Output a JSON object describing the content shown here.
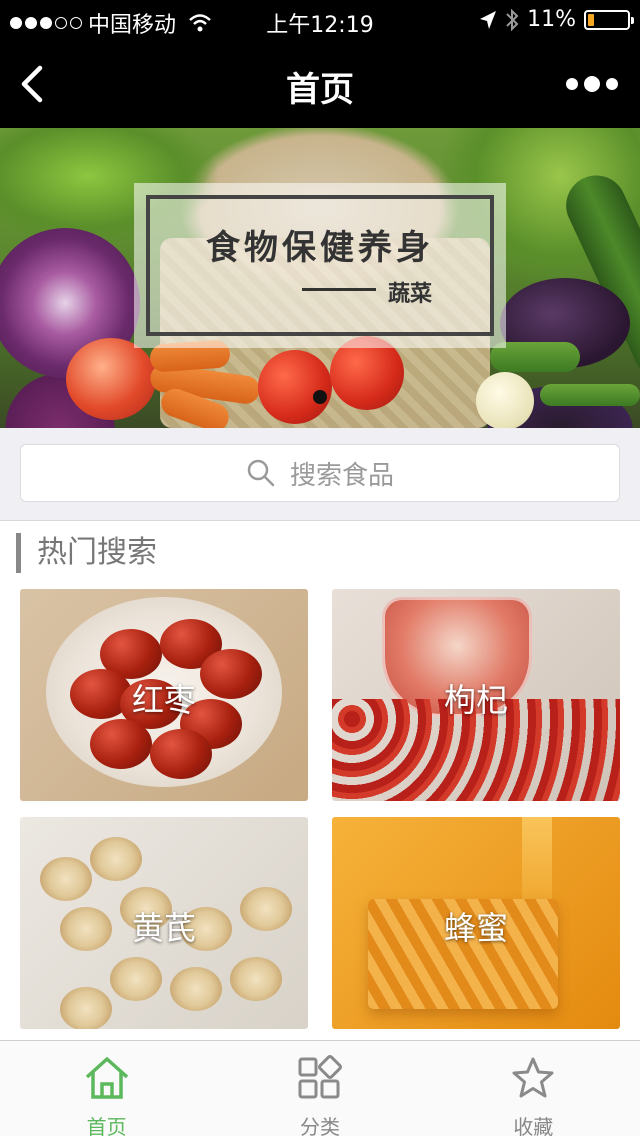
{
  "status_bar": {
    "carrier": "中国移动",
    "time": "上午12:19",
    "battery": "11%"
  },
  "nav": {
    "title": "首页"
  },
  "banner": {
    "headline": "食物保健养身",
    "subtitle": "蔬菜"
  },
  "search": {
    "placeholder": "搜索食品"
  },
  "hot_search": {
    "title": "热门搜索",
    "items": [
      {
        "label": "红枣"
      },
      {
        "label": "枸杞"
      },
      {
        "label": "黄芪"
      },
      {
        "label": "蜂蜜"
      }
    ]
  },
  "tabs": [
    {
      "label": "首页",
      "icon": "home-icon",
      "active": true
    },
    {
      "label": "分类",
      "icon": "category-icon",
      "active": false
    },
    {
      "label": "收藏",
      "icon": "star-icon",
      "active": false
    }
  ],
  "colors": {
    "active_tab": "#5cb85c",
    "bar_background": "#000000",
    "battery": "#f5a623"
  }
}
